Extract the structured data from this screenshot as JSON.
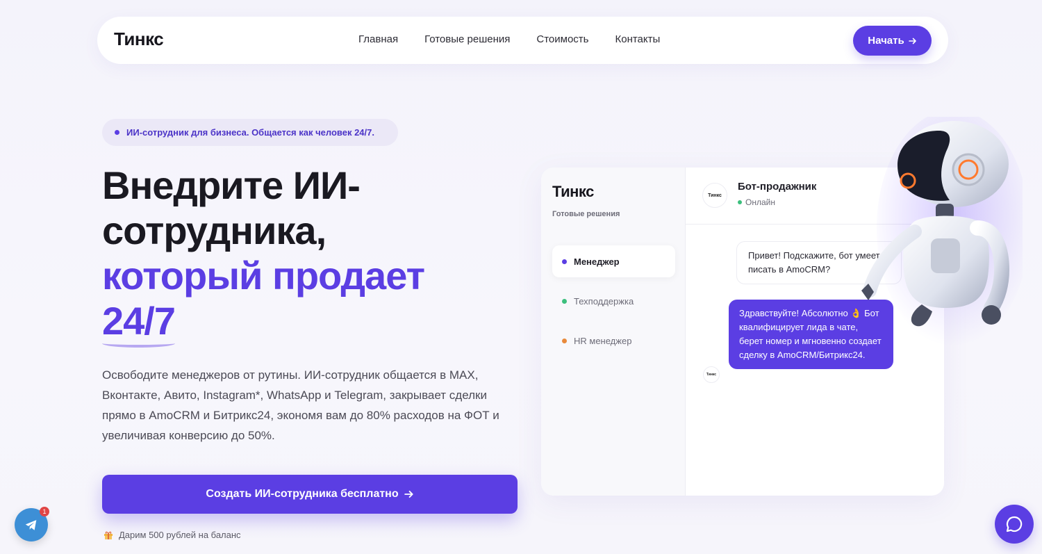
{
  "nav": {
    "logo": "Тинкс",
    "menu": [
      "Главная",
      "Готовые решения",
      "Стоимость",
      "Контакты"
    ],
    "start_label": "Начать"
  },
  "hero": {
    "badge": "ИИ-сотрудник для бизнеса. Общается как человек 24/7.",
    "title_line1": "Внедрите ИИ-",
    "title_line2": "сотрудника,",
    "title_line3": "который продает",
    "title_line4": "24/7",
    "description": "Освободите менеджеров от рутины. ИИ-сотрудник общается в MAX, Вконтакте, Авито, Instagram*, WhatsApp и Telegram, закрывает сделки прямо в AmoCRM и Битрикс24, экономя вам до 80% расходов на ФОТ и увеличивая конверсию до 50%.",
    "cta_label": "Создать ИИ-сотрудника бесплатно",
    "gift_text": "Дарим 500 рублей на баланс"
  },
  "mock": {
    "logo": "Тинкс",
    "subtitle": "Готовые решения",
    "items": [
      {
        "label": "Менеджер",
        "color": "#5b3ee3"
      },
      {
        "label": "Техподдержка",
        "color": "#3cbf7d"
      },
      {
        "label": "HR менеджер",
        "color": "#e88a3c"
      }
    ],
    "avatar_text": "Тинкс",
    "bot_name": "Бот-продажник",
    "bot_status": "Онлайн",
    "msg_in": "Привет! Подскажите, бот умеет писать в AmoCRM?",
    "msg_out": "Здравствуйте! Абсолютно 👌 Бот квалифицирует лида в чате, берет номер и мгновенно создает сделку в AmoCRM/Битрикс24."
  },
  "floating": {
    "telegram_badge": "1"
  },
  "colors": {
    "accent": "#5b3ee3",
    "accent_soft": "#ebe8f7",
    "online": "#3cbf7d"
  }
}
